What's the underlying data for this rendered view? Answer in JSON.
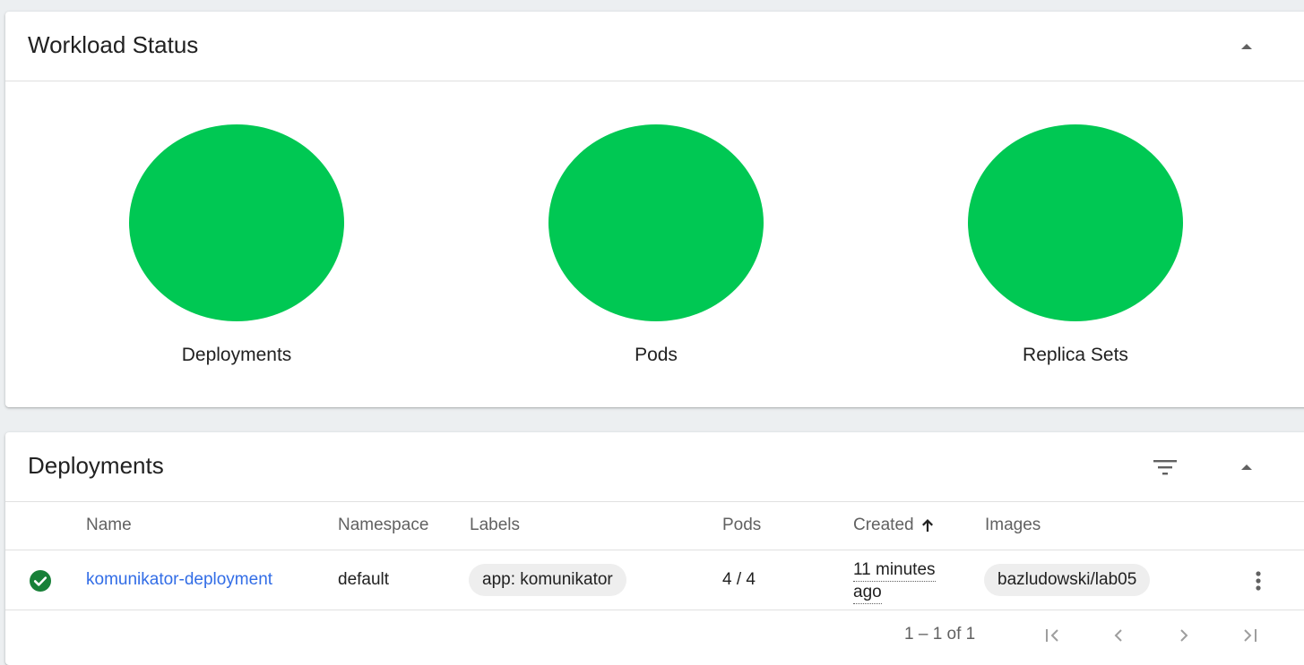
{
  "workload_status": {
    "title": "Workload Status",
    "charts": [
      {
        "label": "Deployments",
        "color": "#00c853"
      },
      {
        "label": "Pods",
        "color": "#00c853"
      },
      {
        "label": "Replica Sets",
        "color": "#00c853"
      }
    ]
  },
  "deployments": {
    "title": "Deployments",
    "columns": [
      "Name",
      "Namespace",
      "Labels",
      "Pods",
      "Created",
      "Images"
    ],
    "sort_column": "Created",
    "rows": [
      {
        "status": "success",
        "name": "komunikator-deployment",
        "namespace": "default",
        "labels": "app: komunikator",
        "pods": "4 / 4",
        "created_line1": "11 minutes",
        "created_line2": "ago",
        "images": "bazludowski/lab05"
      }
    ],
    "pagination": {
      "range": "1 – 1 of 1"
    }
  },
  "colors": {
    "success": "#00c853",
    "status_icon": "#188038",
    "link": "#326de6"
  }
}
